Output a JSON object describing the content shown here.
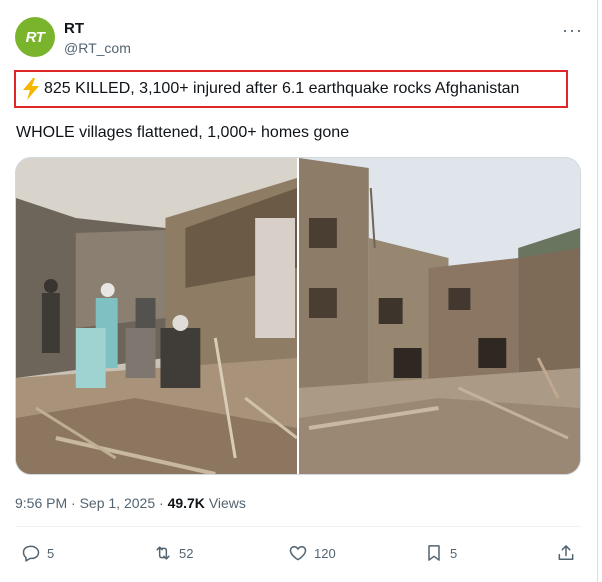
{
  "author": {
    "name": "RT",
    "handle": "@RT_com",
    "avatar_text": "RT",
    "avatar_color": "#7ab42c"
  },
  "more_icon": "more-dots-icon",
  "headline": "825 KILLED, 3,100+ injured after 6.1 earthquake rocks Afghanistan",
  "headline_icon": "lightning-bolt-icon",
  "subtext": "WHOLE villages flattened, 1,000+ homes gone",
  "meta": {
    "time": "9:56 PM",
    "separator": "·",
    "date": "Sep 1, 2025",
    "separator2": "·",
    "views_count": "49.7K",
    "views_label": "Views"
  },
  "actions": {
    "replies": "5",
    "reposts": "52",
    "likes": "120",
    "bookmarks": "5"
  },
  "colors": {
    "highlight_border": "#e02626",
    "text_secondary": "#536471"
  }
}
